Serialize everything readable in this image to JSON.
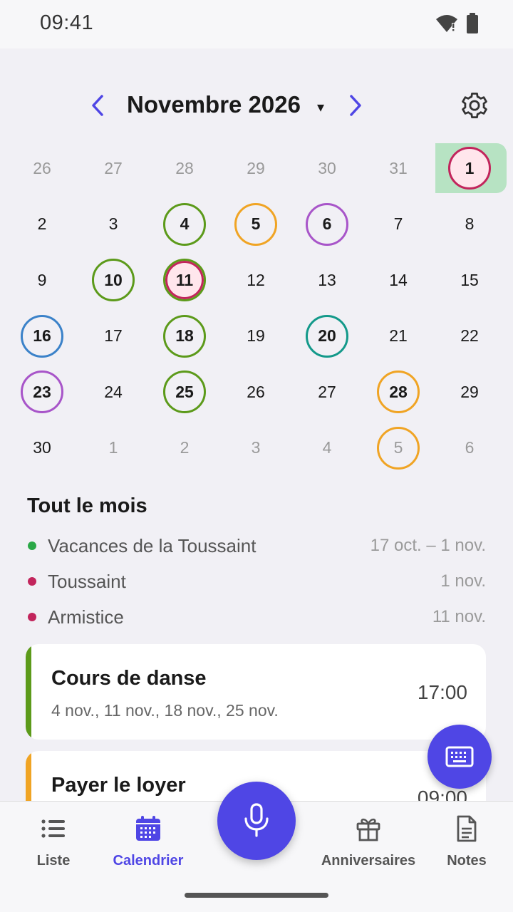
{
  "status_bar": {
    "time": "09:41"
  },
  "calendar": {
    "month_title": "Novembre 2026",
    "dropdown_caret": "▾",
    "weeks": [
      [
        {
          "d": "26",
          "o": true
        },
        {
          "d": "27",
          "o": true
        },
        {
          "d": "28",
          "o": true
        },
        {
          "d": "29",
          "o": true
        },
        {
          "d": "30",
          "o": true
        },
        {
          "d": "31",
          "o": true
        },
        {
          "d": "1",
          "c": "#c2255c",
          "fill": "#ffe6ec",
          "today": true
        }
      ],
      [
        {
          "d": "2"
        },
        {
          "d": "3"
        },
        {
          "d": "4",
          "c": "#5c9a1a"
        },
        {
          "d": "5",
          "c": "#f0a424"
        },
        {
          "d": "6",
          "c": "#a855c9"
        },
        {
          "d": "7"
        },
        {
          "d": "8"
        }
      ],
      [
        {
          "d": "9"
        },
        {
          "d": "10",
          "c": "#5c9a1a"
        },
        {
          "d": "11",
          "c": "#5c9a1a",
          "inner": "#c2255c",
          "fill": "#ffe6ec"
        },
        {
          "d": "12"
        },
        {
          "d": "13"
        },
        {
          "d": "14"
        },
        {
          "d": "15"
        }
      ],
      [
        {
          "d": "16",
          "c": "#3b82c9"
        },
        {
          "d": "17"
        },
        {
          "d": "18",
          "c": "#5c9a1a"
        },
        {
          "d": "19"
        },
        {
          "d": "20",
          "c": "#13998a"
        },
        {
          "d": "21"
        },
        {
          "d": "22"
        }
      ],
      [
        {
          "d": "23",
          "c": "#a855c9"
        },
        {
          "d": "24"
        },
        {
          "d": "25",
          "c": "#5c9a1a"
        },
        {
          "d": "26"
        },
        {
          "d": "27"
        },
        {
          "d": "28",
          "c": "#f0a424"
        },
        {
          "d": "29"
        }
      ],
      [
        {
          "d": "30"
        },
        {
          "d": "1",
          "o": true
        },
        {
          "d": "2",
          "o": true
        },
        {
          "d": "3",
          "o": true
        },
        {
          "d": "4",
          "o": true
        },
        {
          "d": "5",
          "o": true,
          "c": "#f0a424"
        },
        {
          "d": "6",
          "o": true
        }
      ]
    ]
  },
  "month_events": {
    "title": "Tout le mois",
    "items": [
      {
        "name": "Vacances de la Toussaint",
        "date": "17 oct. – 1 nov.",
        "color": "#2aa847"
      },
      {
        "name": "Toussaint",
        "date": "1 nov.",
        "color": "#c2255c"
      },
      {
        "name": "Armistice",
        "date": "11 nov.",
        "color": "#c2255c"
      }
    ]
  },
  "cards": [
    {
      "title": "Cours de danse",
      "subtitle": "4 nov., 11 nov., 18 nov., 25 nov.",
      "time": "17:00",
      "color": "#5c9a1a"
    },
    {
      "title": "Payer le loyer",
      "subtitle": "",
      "time": "09:00",
      "color": "#f0a424"
    }
  ],
  "bottom_nav": {
    "liste": "Liste",
    "calendrier": "Calendrier",
    "anniversaires": "Anniversaires",
    "notes": "Notes"
  },
  "colors": {
    "accent": "#4f46e5",
    "today_bg": "#b7e3c3"
  }
}
